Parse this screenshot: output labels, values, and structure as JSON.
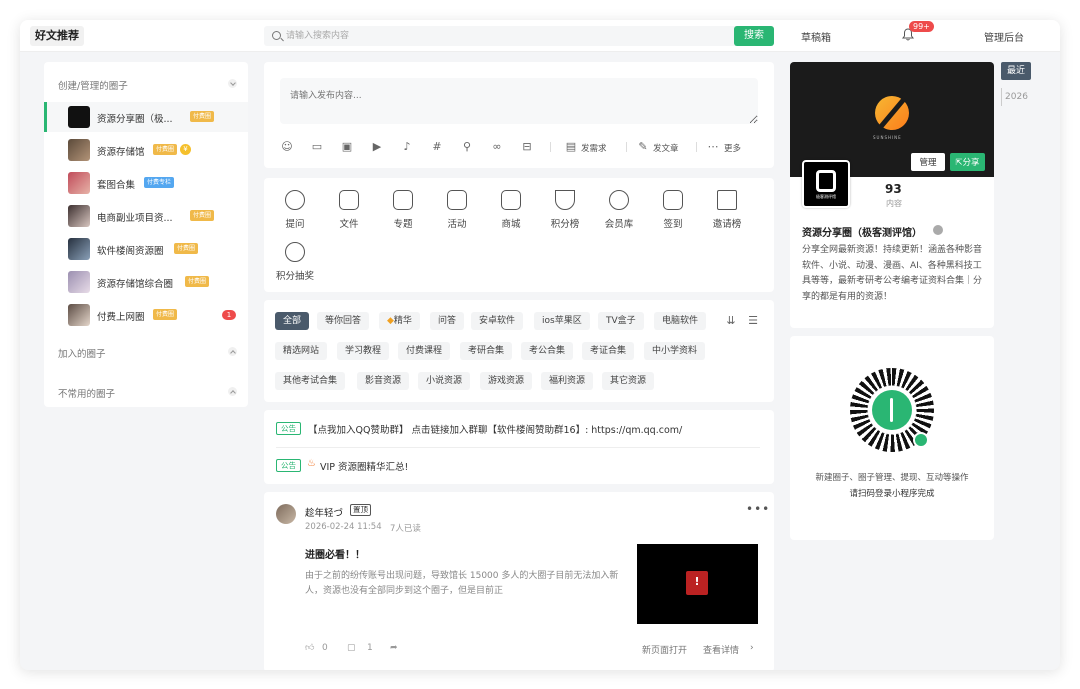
{
  "header": {
    "logo": "好文推荐",
    "search_placeholder": "请输入搜索内容",
    "search_button": "搜索",
    "drafts": "草稿箱",
    "notify_badge": "99+",
    "admin": "管理后台"
  },
  "sidebar": {
    "created_title": "创建/管理的圈子",
    "joined_title": "加入的圈子",
    "unused_title": "不常用的圈子",
    "paid_label": "付费圈",
    "circles": [
      {
        "name": "资源分享圈（极...",
        "tag": "付费圈"
      },
      {
        "name": "资源存储馆",
        "tag": "付费圈"
      },
      {
        "name": "套图合集",
        "tag": "付费专栏"
      },
      {
        "name": "电商副业项目资...",
        "tag": "付费圈"
      },
      {
        "name": "软件楼阁资源圈",
        "tag": "付费圈"
      },
      {
        "name": "资源存储馆综合圈",
        "tag": "付费圈"
      },
      {
        "name": "付费上网圈",
        "tag": "付费圈",
        "count": "1"
      }
    ]
  },
  "composer": {
    "placeholder": "请输入发布内容...",
    "demand": "发需求",
    "article": "发文章",
    "more": "更多"
  },
  "categories": [
    "提问",
    "文件",
    "专题",
    "活动",
    "商城",
    "积分榜",
    "会员库",
    "签到",
    "邀请榜",
    "积分抽奖"
  ],
  "tags": {
    "row1": [
      "全部",
      "等你回答",
      "精华",
      "问答",
      "安卓软件",
      "ios苹果区",
      "TV盒子",
      "电脑软件"
    ],
    "row2": [
      "精选网站",
      "学习教程",
      "付费课程",
      "考研合集",
      "考公合集",
      "考证合集",
      "中小学资料"
    ],
    "row3": [
      "其他考试合集",
      "影音资源",
      "小说资源",
      "游戏资源",
      "福利资源",
      "其它资源"
    ]
  },
  "notices": [
    {
      "tag": "公告",
      "text": "【点我加入QQ赞助群】 点击链接加入群聊【软件楼阁赞助群16】: https://qm.qq.com/"
    },
    {
      "tag": "公告",
      "text": "VIP 资源圈精华汇总!"
    }
  ],
  "post": {
    "author": "趁年轻づ",
    "pin": "置顶",
    "datetime": "2026-02-24 11:54",
    "views": "7人已读",
    "title": "进圈必看！！",
    "body": "由于之前的纷传账号出现问题，导致馆长 15000 多人的大圈子目前无法加入新人，资源也没有全部同步到这个圈子，但是目前正",
    "likes": "0",
    "comments": "1",
    "open_new": "新页面打开",
    "detail": "查看详情"
  },
  "profile": {
    "banner_text": "SUNSHINE",
    "manage": "管理",
    "share": "分享",
    "logo_text": "极客测评馆",
    "content_count": "93",
    "content_label": "内容",
    "name": "资源分享圈（极客测评馆）",
    "desc": "分享全网最新资源！持续更新！涵盖各种影音软件、小说、动漫、漫画、AI、各种黑科技工具等等，最新考研考公考编考证资料合集｜分享的都是有用的资源！"
  },
  "qr": {
    "line1": "新建圈子、圈子管理、提现、互动等操作",
    "line2": "请扫码登录小程序完成"
  },
  "timeline": {
    "active": "最近",
    "year": "2026"
  },
  "colors": {
    "accent": "#2ab673",
    "paid": "#f0b949",
    "badge": "#ee4b4b"
  }
}
